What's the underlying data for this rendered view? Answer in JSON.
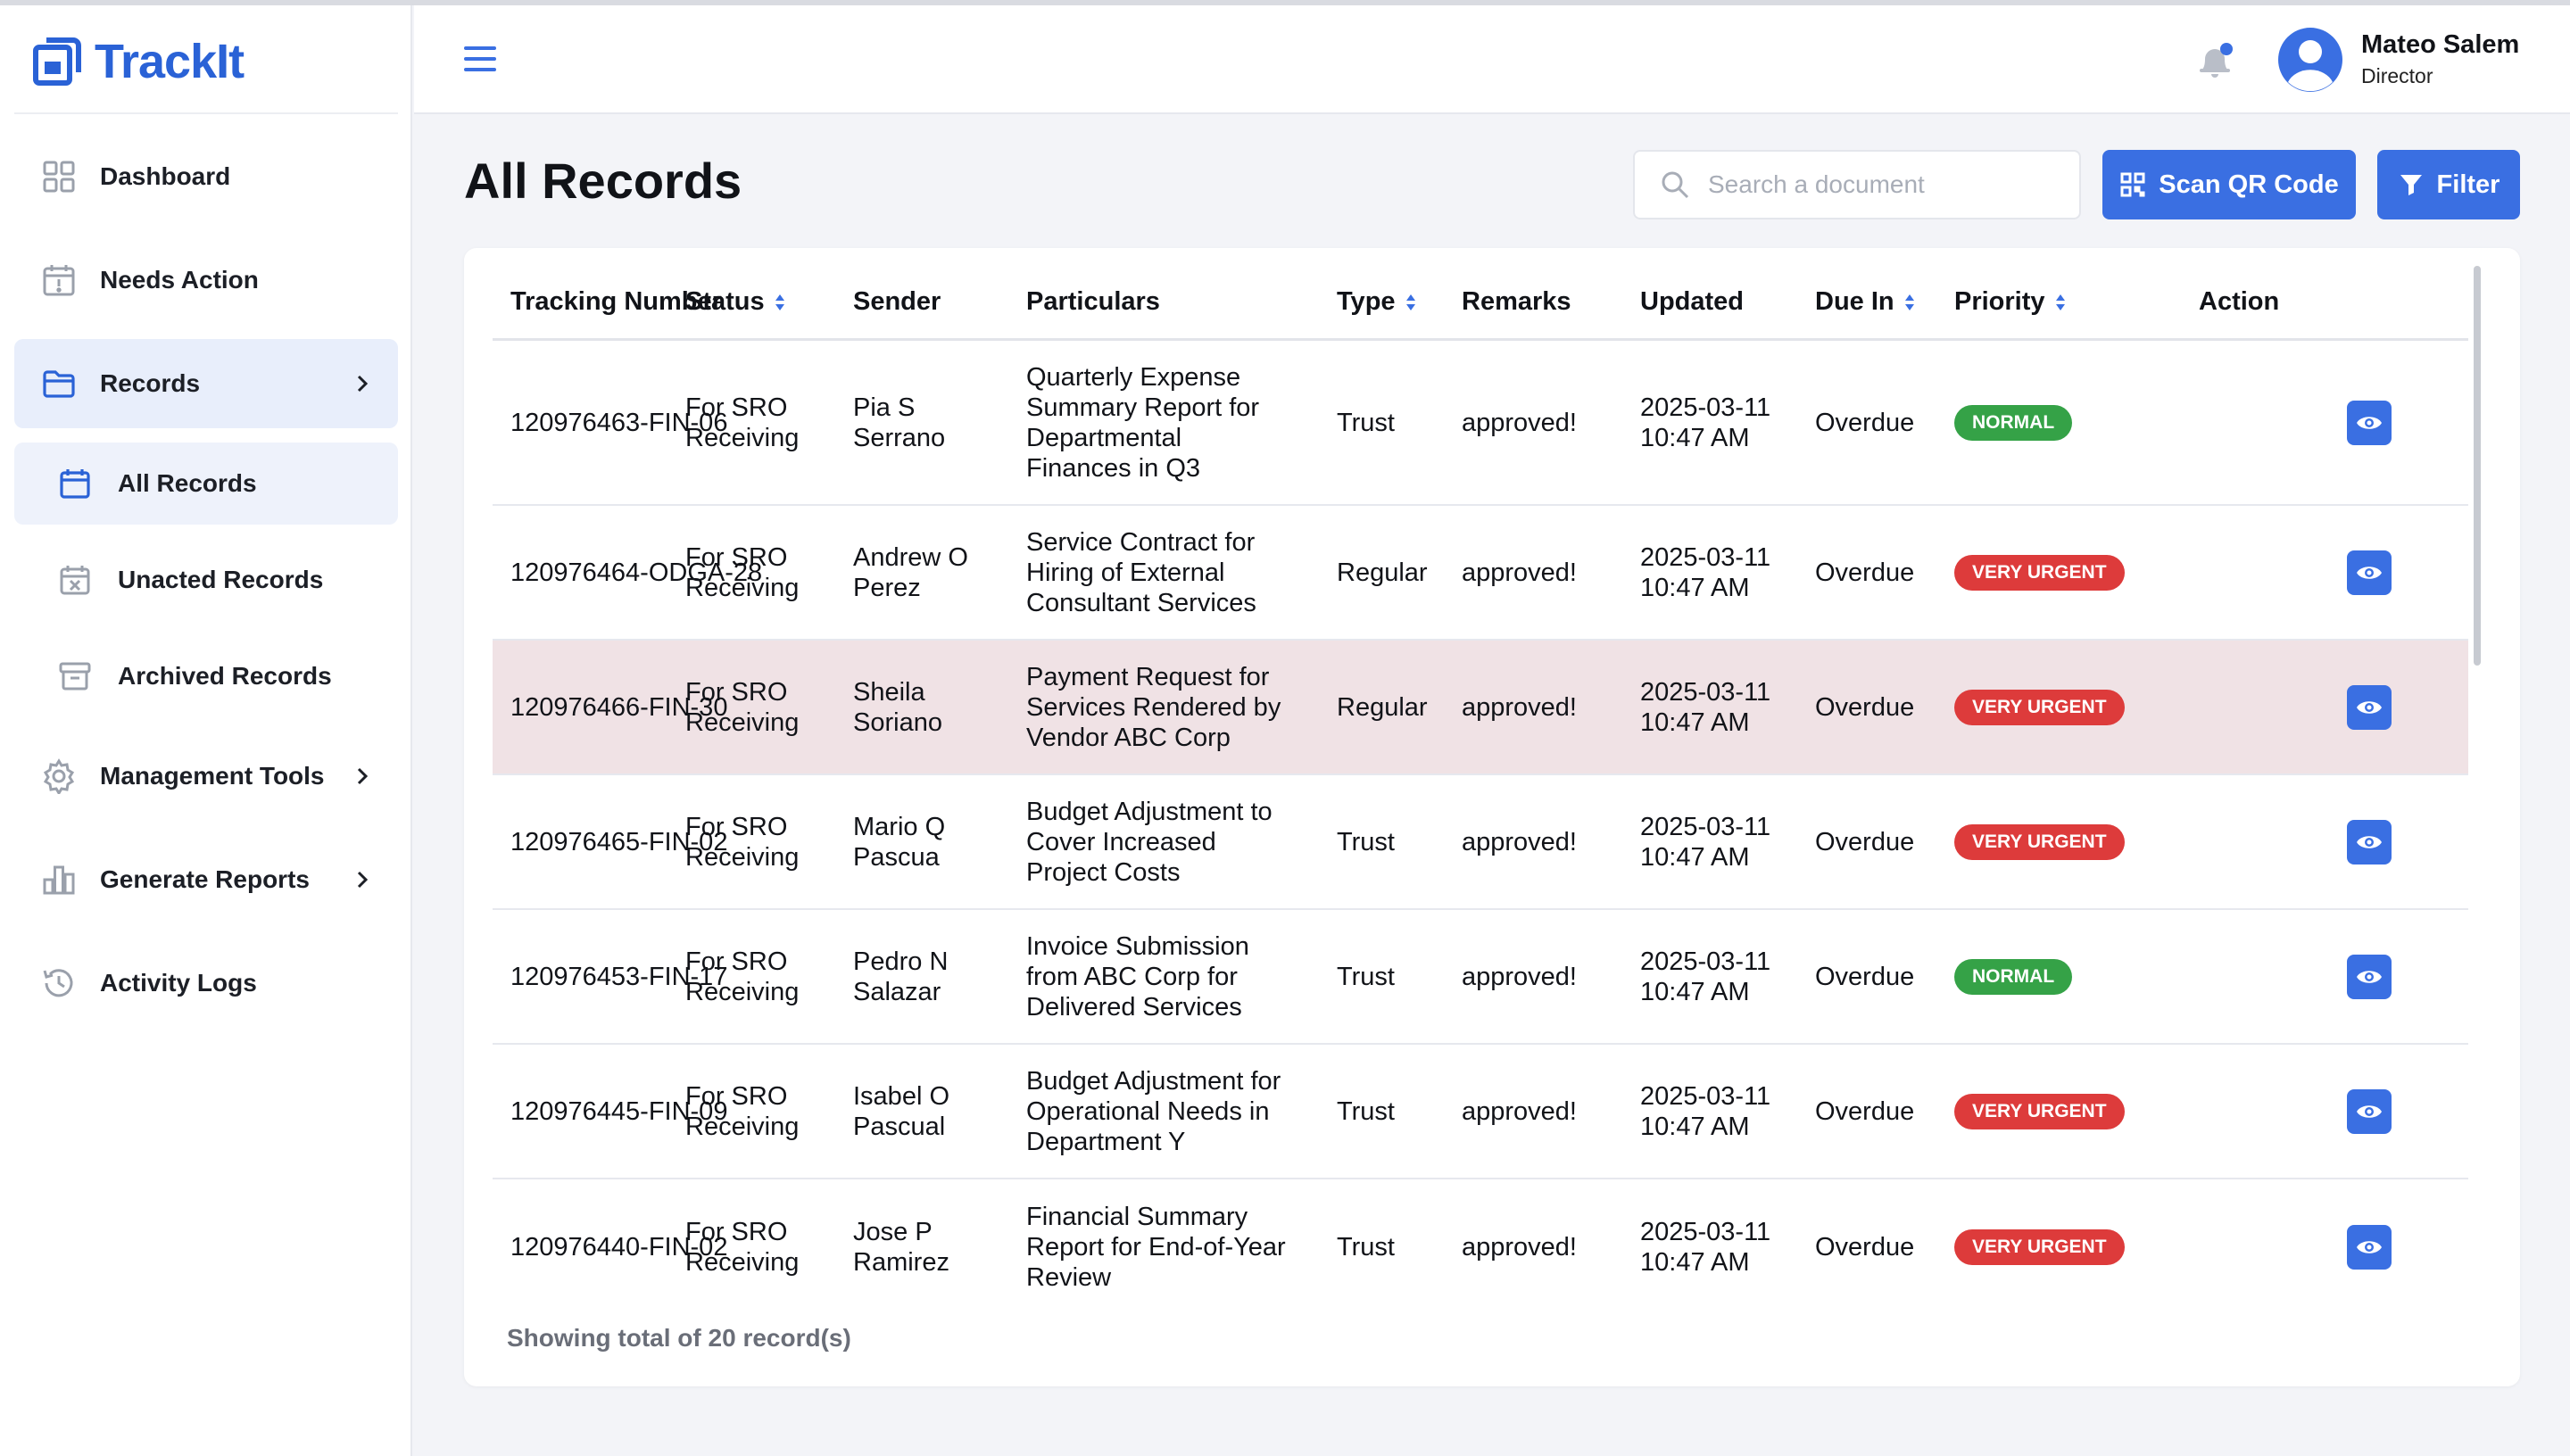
{
  "app": {
    "name": "TrackIt",
    "brand_color": "#2a62d6",
    "accent": "#3a6fe2"
  },
  "sidebar": {
    "items": [
      {
        "label": "Dashboard",
        "icon": "grid-icon"
      },
      {
        "label": "Needs Action",
        "icon": "calendar-alert-icon"
      },
      {
        "label": "Records",
        "icon": "folder-icon",
        "active": true
      },
      {
        "label": "All Records",
        "icon": "calendar-icon",
        "sub": true,
        "selected": true
      },
      {
        "label": "Unacted Records",
        "icon": "calendar-x-icon",
        "sub": true
      },
      {
        "label": "Archived Records",
        "icon": "archive-icon",
        "sub": true
      },
      {
        "label": "Management Tools",
        "icon": "gear-icon"
      },
      {
        "label": "Generate Reports",
        "icon": "bar-chart-icon"
      },
      {
        "label": "Activity Logs",
        "icon": "history-icon"
      }
    ]
  },
  "header": {
    "user": {
      "name": "Mateo Salem",
      "role": "Director"
    }
  },
  "page": {
    "title": "All Records",
    "search_placeholder": "Search a document",
    "scan_label": "Scan QR Code",
    "filter_label": "Filter"
  },
  "table": {
    "columns": [
      "Tracking Number",
      "Status",
      "Sender",
      "Particulars",
      "Type",
      "Remarks",
      "Updated",
      "Due In",
      "Priority",
      "Action"
    ],
    "rows": [
      {
        "tracking": "120976463-FIN-06",
        "status": "For SRO\nReceiving",
        "sender": "Pia S\nSerrano",
        "particulars": "Quarterly Expense\nSummary Report for\nDepartmental\nFinances in Q3",
        "type": "Trust",
        "remarks": "approved!",
        "updated": "2025-03-11\n10:47 AM",
        "due": "Overdue",
        "priority": "NORMAL"
      },
      {
        "tracking": "120976464-ODGA-28",
        "status": "For SRO\nReceiving",
        "sender": "Andrew O\nPerez",
        "particulars": "Service Contract for\nHiring of External\nConsultant Services",
        "type": "Regular",
        "remarks": "approved!",
        "updated": "2025-03-11\n10:47 AM",
        "due": "Overdue",
        "priority": "VERY URGENT"
      },
      {
        "tracking": "120976466-FIN-30",
        "status": "For SRO\nReceiving",
        "sender": "Sheila\nSoriano",
        "particulars": "Payment Request for\nServices Rendered by\nVendor ABC Corp",
        "type": "Regular",
        "remarks": "approved!",
        "updated": "2025-03-11\n10:47 AM",
        "due": "Overdue",
        "priority": "VERY URGENT"
      },
      {
        "tracking": "120976465-FIN-02",
        "status": "For SRO\nReceiving",
        "sender": "Mario Q\nPascua",
        "particulars": "Budget Adjustment to\nCover Increased\nProject Costs",
        "type": "Trust",
        "remarks": "approved!",
        "updated": "2025-03-11\n10:47 AM",
        "due": "Overdue",
        "priority": "VERY URGENT"
      },
      {
        "tracking": "120976453-FIN-17",
        "status": "For SRO\nReceiving",
        "sender": "Pedro N\nSalazar",
        "particulars": "Invoice Submission\nfrom ABC Corp for\nDelivered Services",
        "type": "Trust",
        "remarks": "approved!",
        "updated": "2025-03-11\n10:47 AM",
        "due": "Overdue",
        "priority": "NORMAL"
      },
      {
        "tracking": "120976445-FIN-09",
        "status": "For SRO\nReceiving",
        "sender": "Isabel O\nPascual",
        "particulars": "Budget Adjustment for\nOperational Needs in\nDepartment Y",
        "type": "Trust",
        "remarks": "approved!",
        "updated": "2025-03-11\n10:47 AM",
        "due": "Overdue",
        "priority": "VERY URGENT"
      },
      {
        "tracking": "120976440-FIN-02",
        "status": "For SRO\nReceiving",
        "sender": "Jose P\nRamirez",
        "particulars": "Financial Summary\nReport for End-of-Year\nReview",
        "type": "Trust",
        "remarks": "approved!",
        "updated": "2025-03-11\n10:47 AM",
        "due": "Overdue",
        "priority": "VERY URGENT"
      }
    ],
    "footer": "Showing total of 20 record(s)"
  }
}
